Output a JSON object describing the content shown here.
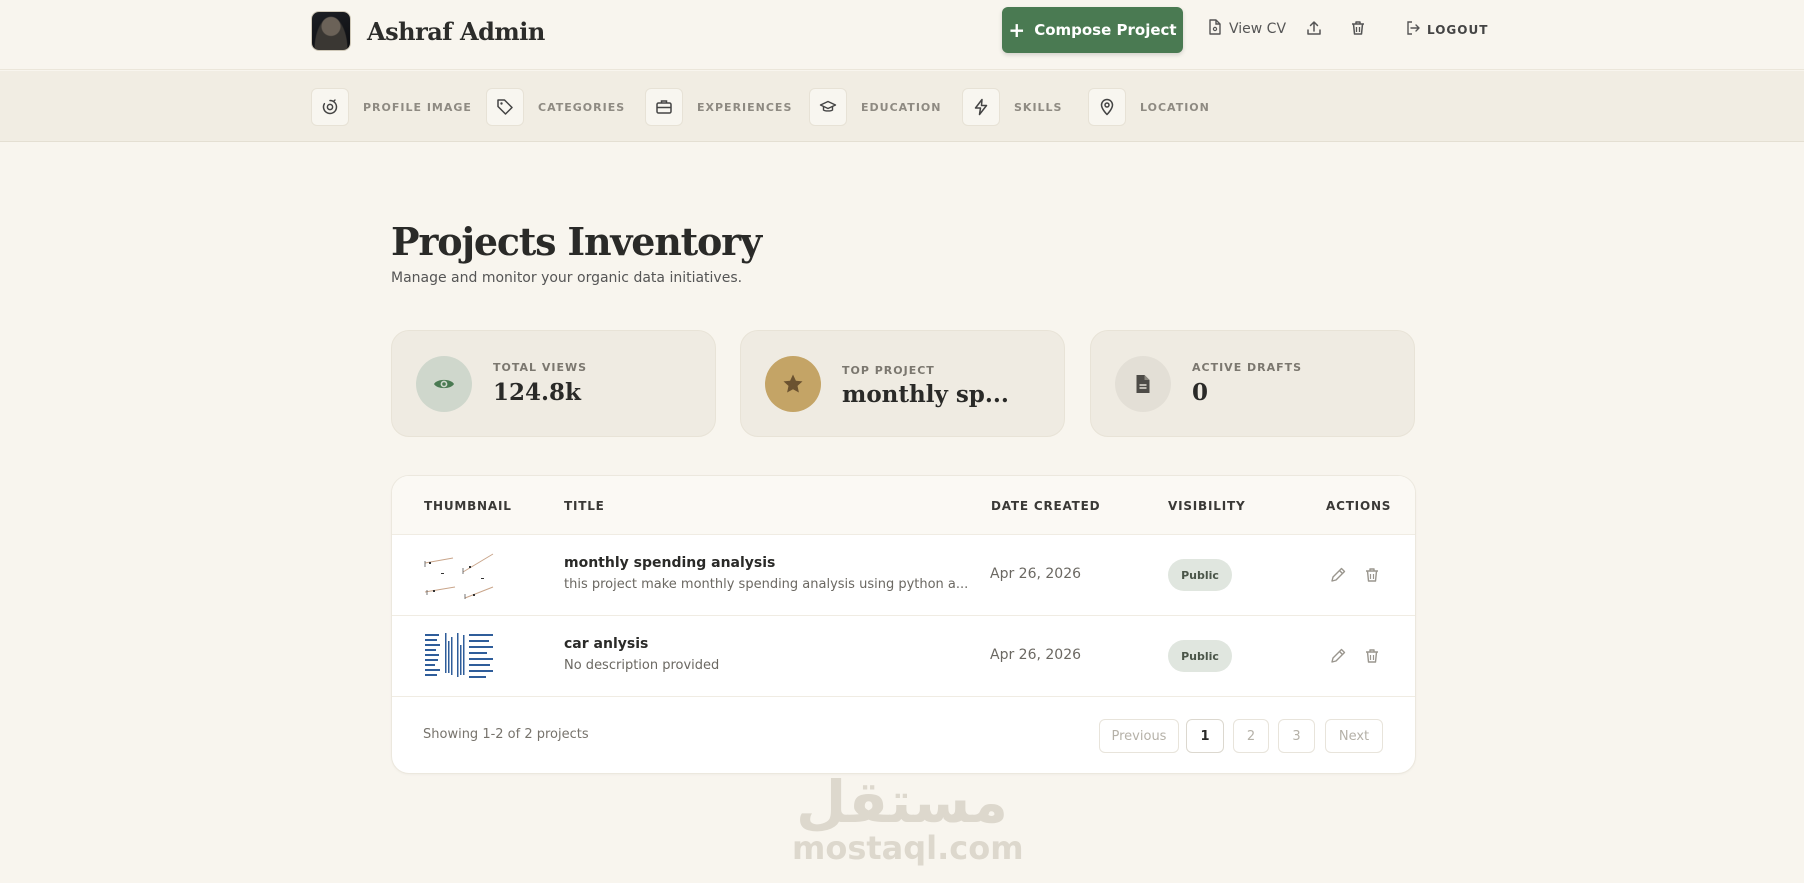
{
  "header": {
    "brand_name": "Ashraf Admin",
    "compose_label": "Compose Project",
    "view_cv_label": "View CV",
    "logout_label": "LOGOUT"
  },
  "subnav": {
    "items": [
      {
        "label": "PROFILE IMAGE",
        "icon": "profile-image-icon"
      },
      {
        "label": "CATEGORIES",
        "icon": "tag-icon"
      },
      {
        "label": "EXPERIENCES",
        "icon": "briefcase-icon"
      },
      {
        "label": "EDUCATION",
        "icon": "graduation-cap-icon"
      },
      {
        "label": "SKILLS",
        "icon": "lightning-icon"
      },
      {
        "label": "LOCATION",
        "icon": "map-pin-icon"
      }
    ]
  },
  "page": {
    "title": "Projects Inventory",
    "subtitle": "Manage and monitor your organic data initiatives."
  },
  "stats": [
    {
      "label": "TOTAL VIEWS",
      "value": "124.8k",
      "icon": "eye-icon"
    },
    {
      "label": "TOP PROJECT",
      "value": "monthly sp...",
      "icon": "star-icon"
    },
    {
      "label": "ACTIVE DRAFTS",
      "value": "0",
      "icon": "document-icon"
    }
  ],
  "table": {
    "columns": [
      "THUMBNAIL",
      "TITLE",
      "DATE CREATED",
      "VISIBILITY",
      "ACTIONS"
    ],
    "rows": [
      {
        "title": "monthly spending analysis",
        "description": "this project make monthly spending analysis using python a...",
        "date": "Apr 26, 2026",
        "visibility": "Public"
      },
      {
        "title": "car anlysis",
        "description": "No description provided",
        "date": "Apr 26, 2026",
        "visibility": "Public"
      }
    ]
  },
  "pagination": {
    "summary": "Showing 1-2 of 2 projects",
    "previous": "Previous",
    "pages": [
      "1",
      "2",
      "3"
    ],
    "current_page": "1",
    "next": "Next"
  },
  "watermark": {
    "arabic": "مستقل",
    "latin": "mostaql.com"
  },
  "colors": {
    "background": "#f8f5ee",
    "accent_green": "#4a7a52",
    "top_project_gold": "#c4a466",
    "badge_bg": "#e0e6df"
  }
}
